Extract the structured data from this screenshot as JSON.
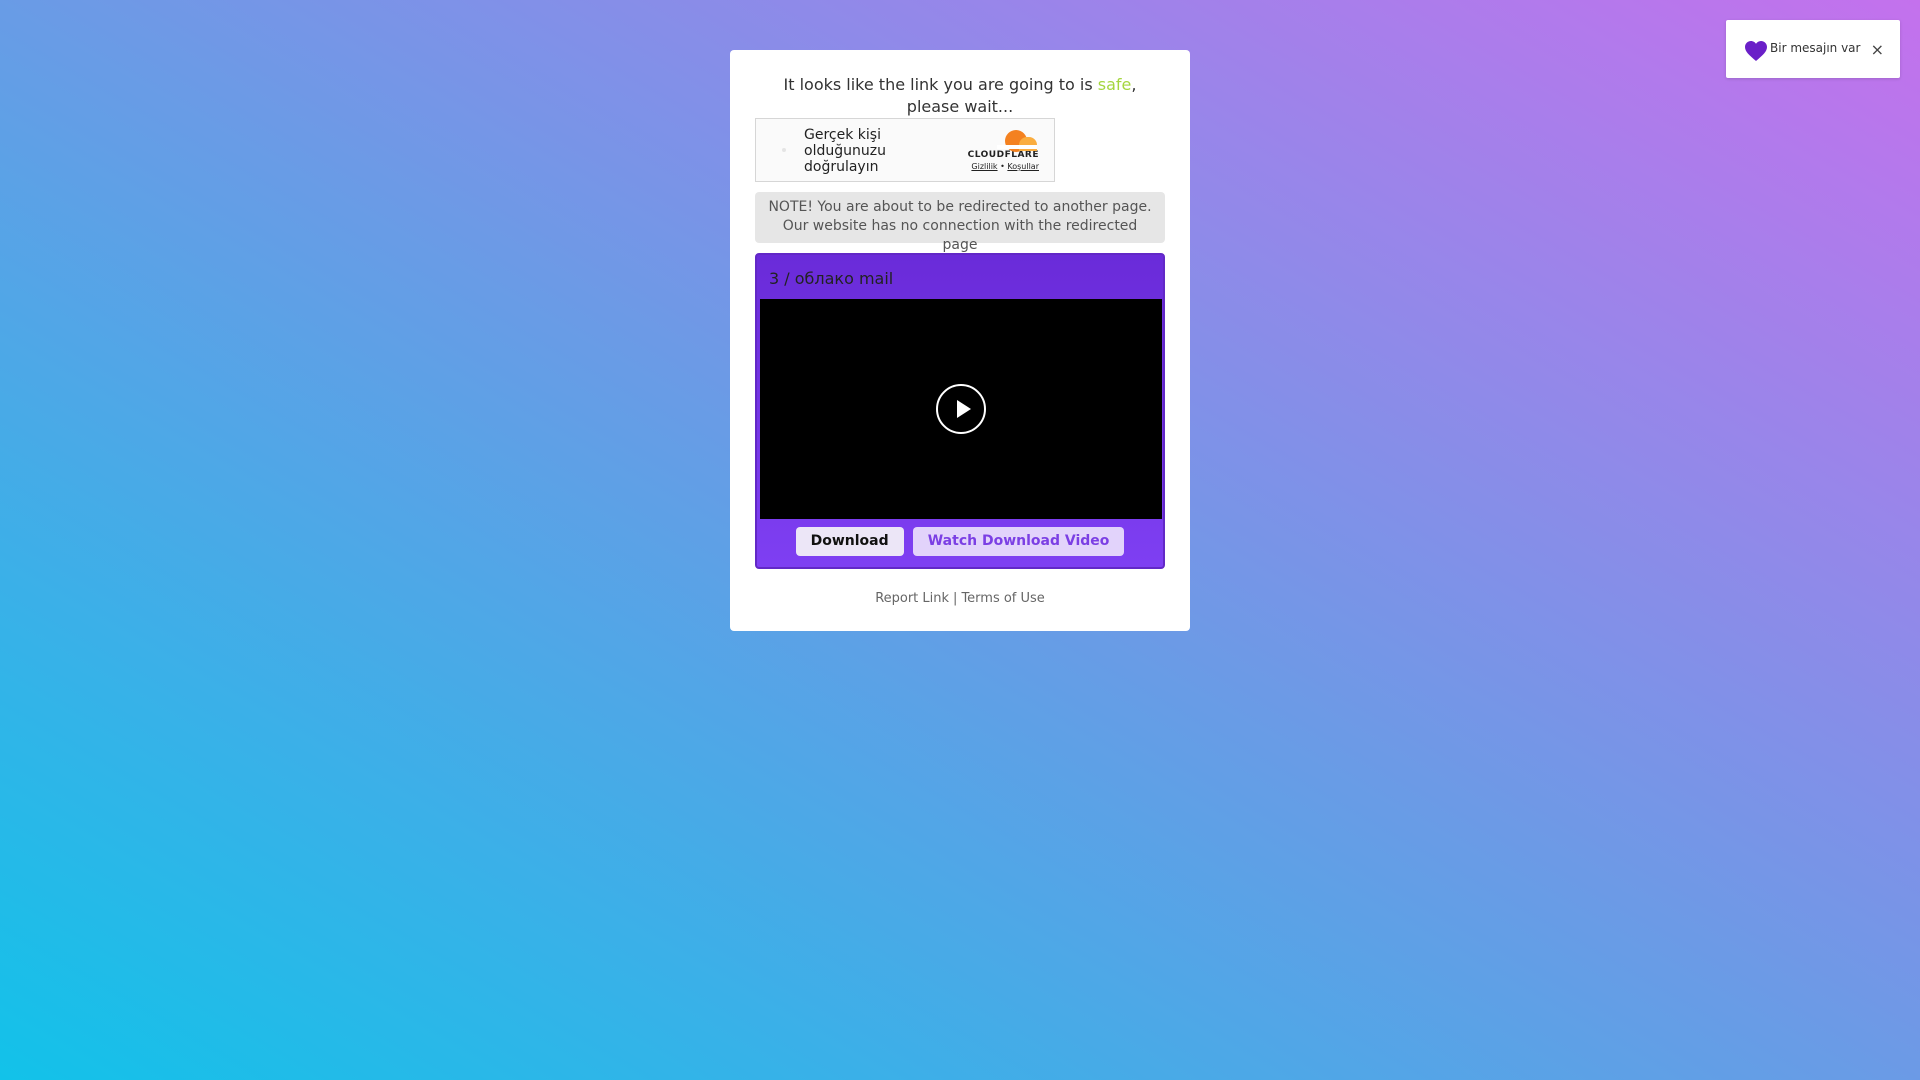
{
  "card": {
    "headline_before": "It looks like the link you are going to is ",
    "headline_safe": "safe",
    "headline_after": ", please wait...",
    "captcha": {
      "label": "Gerçek kişi olduğunuzu doğrulayın",
      "brand": "CLOUDFLARE",
      "privacy_link": "Gizlilik",
      "separator": "•",
      "terms_link": "Koşullar"
    },
    "note_icon": "",
    "note_text": "NOTE! You are about to be redirected to another page. Our website has no connection with the redirected page",
    "video": {
      "title": "3 / облако mail",
      "download_label": "Download",
      "watch_label": "Watch Download Video"
    },
    "footer": {
      "report_label": "Report Link",
      "separator": "|",
      "terms_label": "Terms of Use"
    }
  },
  "toast": {
    "message": "Bir mesajın var",
    "close_symbol": "×"
  },
  "colors": {
    "safe": "#a5d63f",
    "video_box": "#7e3ff2",
    "heart": "#6a1fc8"
  },
  "icons": {
    "play": "play-icon",
    "heart": "heart-icon",
    "close": "close-icon",
    "cloud": "cloudflare-logo-icon"
  }
}
